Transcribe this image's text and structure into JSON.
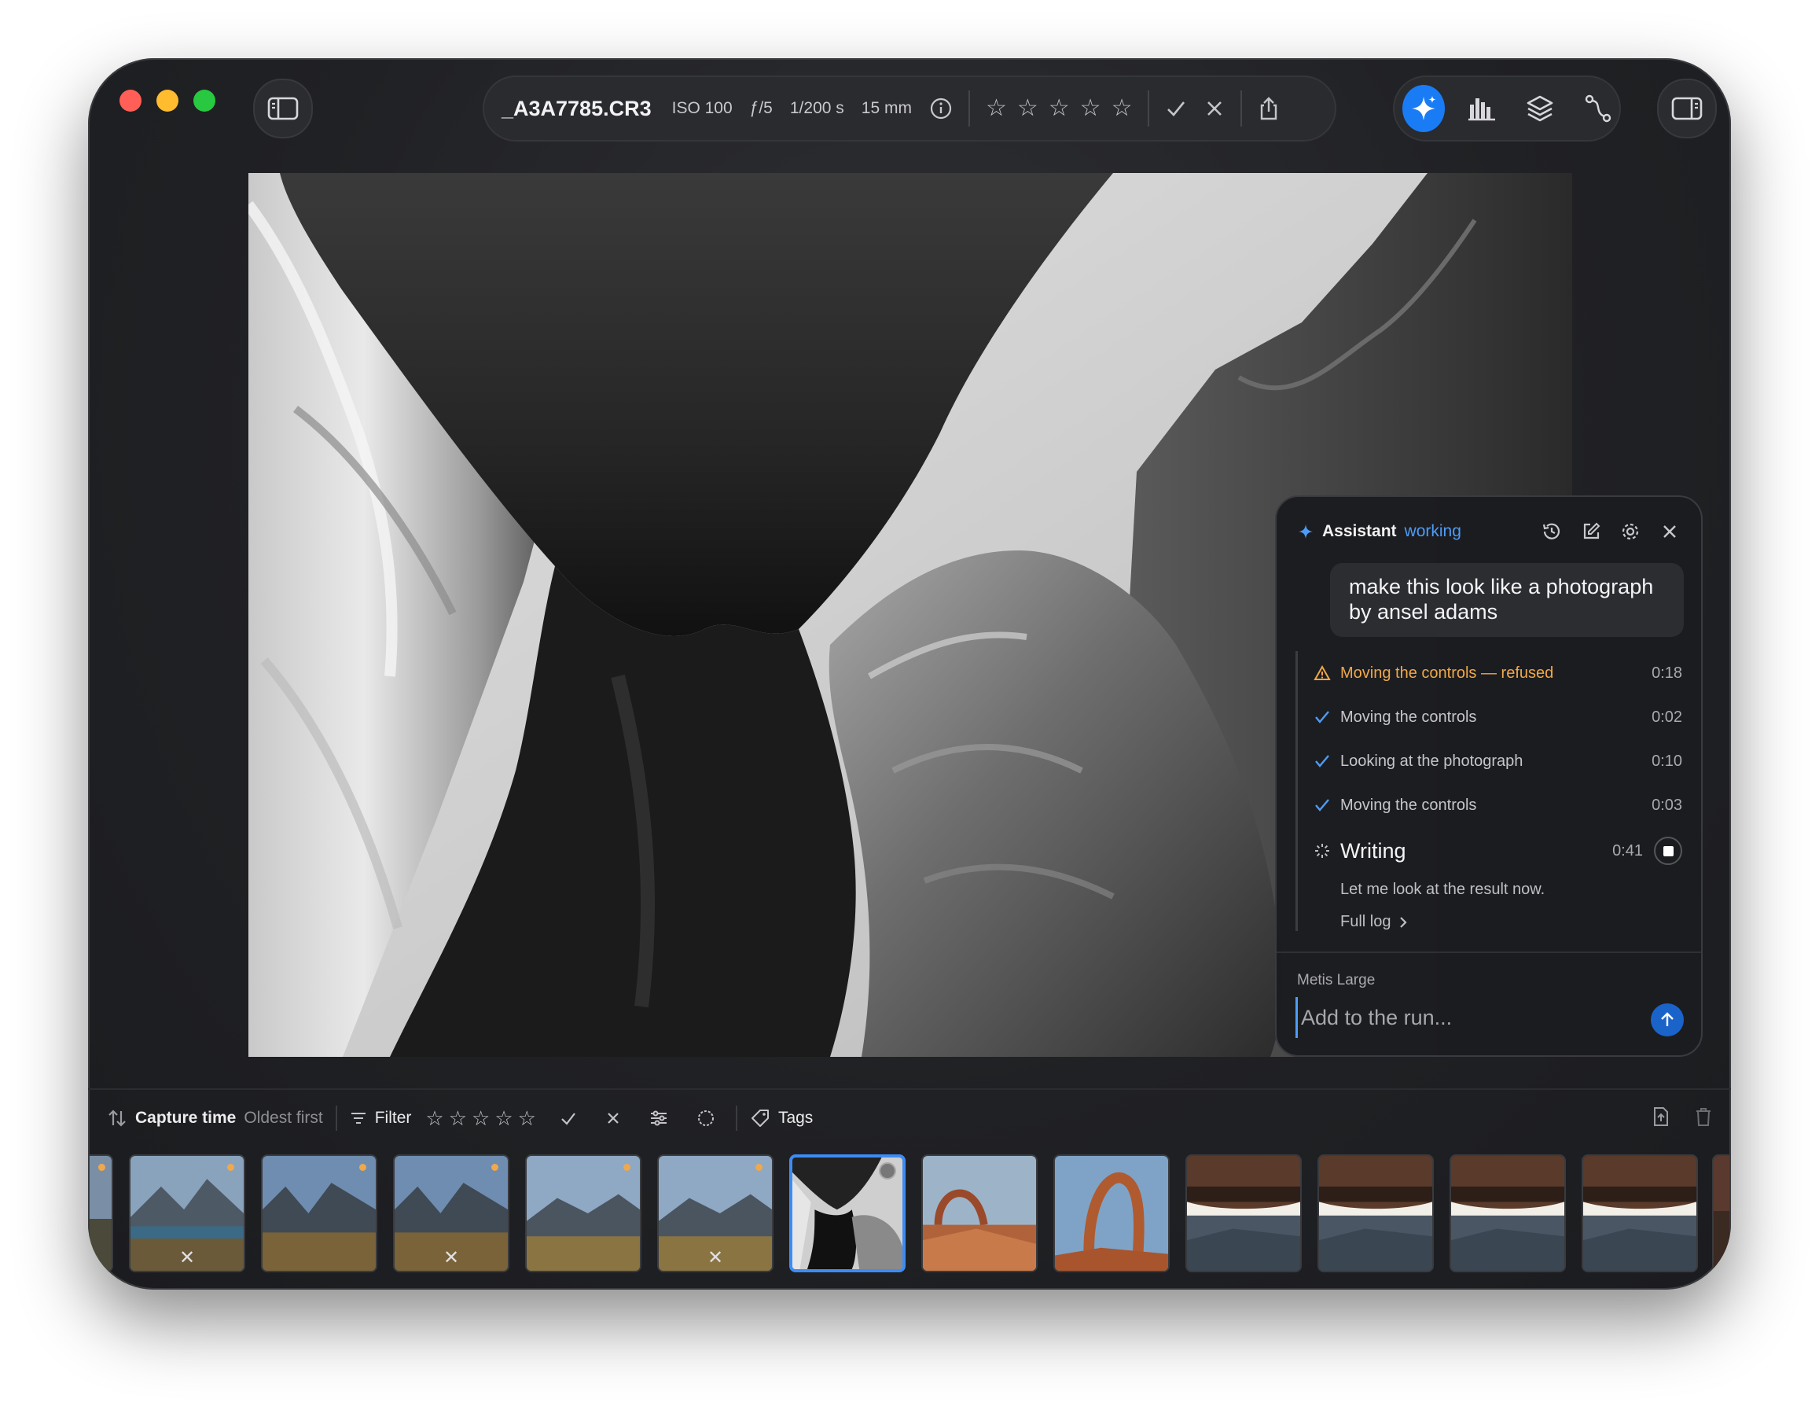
{
  "header": {
    "filename": "_A3A7785.CR3",
    "exif": {
      "iso": "ISO 100",
      "aperture": "ƒ/5",
      "shutter": "1/200 s",
      "focal": "15 mm"
    }
  },
  "assistant": {
    "title": "Assistant",
    "status": "working",
    "user_message": "make this look like a photograph by ansel adams",
    "steps": [
      {
        "label": "Moving the controls — refused",
        "time": "0:18",
        "state": "warning"
      },
      {
        "label": "Moving the controls",
        "time": "0:02",
        "state": "done"
      },
      {
        "label": "Looking at the photograph",
        "time": "0:10",
        "state": "done"
      },
      {
        "label": "Moving the controls",
        "time": "0:03",
        "state": "done"
      }
    ],
    "current": {
      "label": "Writing",
      "time": "0:41",
      "text": "Let me look at the result now."
    },
    "full_log_label": "Full log",
    "model": "Metis Large",
    "input_placeholder": "Add to the run..."
  },
  "filmstrip_toolbar": {
    "sort_label": "Capture time",
    "sort_order": "Oldest first",
    "filter_label": "Filter",
    "tags_label": "Tags"
  },
  "colors": {
    "accent": "#1a7cf5",
    "warning": "#f0a84a",
    "flag": "#f0a84a"
  },
  "filmstrip": {
    "thumbnails": [
      {
        "scene": "mountain-lake",
        "flag": true,
        "rejected": true
      },
      {
        "scene": "mountain-valley",
        "flag": true,
        "rejected": false
      },
      {
        "scene": "mountain-valley",
        "flag": true,
        "rejected": true
      },
      {
        "scene": "mountain-meadow",
        "flag": true,
        "rejected": false
      },
      {
        "scene": "mountain-meadow",
        "flag": true,
        "rejected": true
      },
      {
        "scene": "bw-rock-arch",
        "flag": false,
        "rejected": false,
        "selected": true
      },
      {
        "scene": "red-rock-arch",
        "flag": false,
        "rejected": false
      },
      {
        "scene": "delicate-arch",
        "flag": false,
        "rejected": false
      },
      {
        "scene": "mesa-arch",
        "flag": false,
        "rejected": false
      },
      {
        "scene": "mesa-arch",
        "flag": false,
        "rejected": false
      },
      {
        "scene": "mesa-arch",
        "flag": false,
        "rejected": false
      },
      {
        "scene": "mesa-arch",
        "flag": false,
        "rejected": false
      }
    ]
  }
}
